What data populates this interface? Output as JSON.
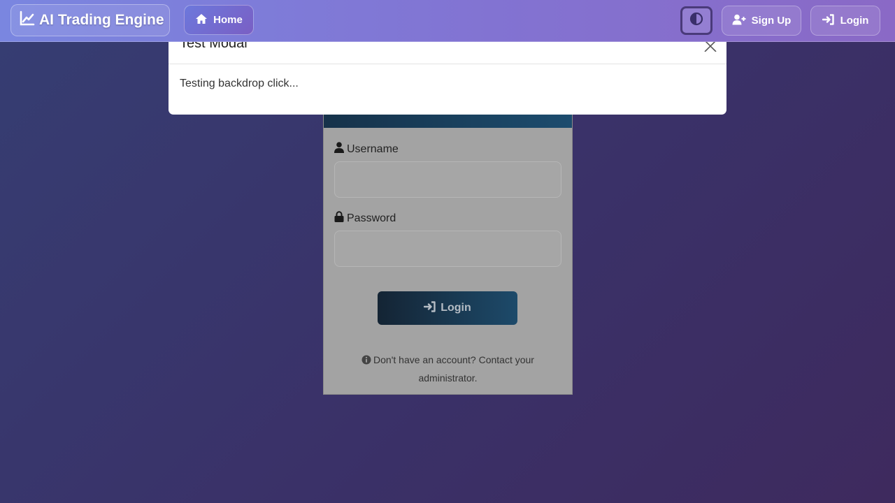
{
  "navbar": {
    "brand": "AI Trading Engine",
    "home": "Home",
    "sign_up": "Sign Up",
    "login": "Login"
  },
  "login_form": {
    "username_label": "Username",
    "password_label": "Password",
    "submit_label": "Login",
    "footer_text": "Don't have an account? Contact your administrator."
  },
  "modal": {
    "title": "Test Modal",
    "body": "Testing backdrop click..."
  },
  "icons": {
    "brand": "chart-line-icon",
    "home": "home-icon",
    "theme": "contrast-icon",
    "sign_up": "user-plus-icon",
    "login": "sign-in-icon",
    "username": "user-icon",
    "password": "lock-icon",
    "info": "info-icon",
    "close": "close-icon"
  },
  "colors": {
    "backdrop": "#3a3168",
    "navbar": "#8273d2",
    "button_dark": "#1d4a6a"
  }
}
